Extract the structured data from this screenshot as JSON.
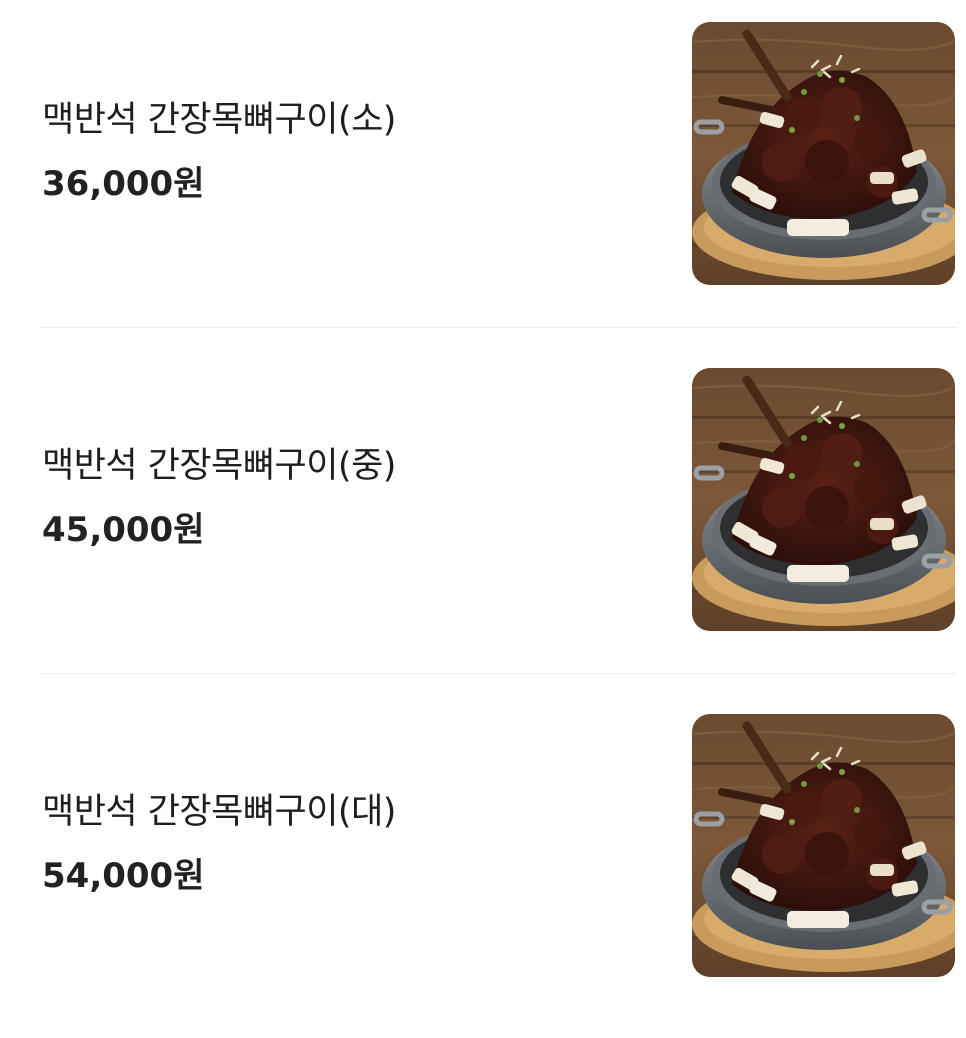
{
  "menu": {
    "items": [
      {
        "name": "맥반석 간장목뼈구이(소)",
        "price": "36,000원",
        "image": "food-photo"
      },
      {
        "name": "맥반석 간장목뼈구이(중)",
        "price": "45,000원",
        "image": "food-photo"
      },
      {
        "name": "맥반석 간장목뼈구이(대)",
        "price": "54,000원",
        "image": "food-photo"
      }
    ]
  },
  "colors": {
    "text": "#1e1e1e",
    "divider": "#ececec",
    "background": "#ffffff"
  }
}
